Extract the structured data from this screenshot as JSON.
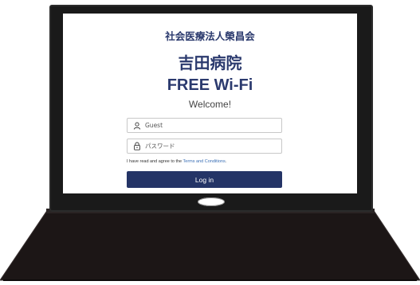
{
  "portal": {
    "org_name": "社会医療法人榮昌会",
    "hospital_name": "吉田病院",
    "wifi_title": "FREE Wi-Fi",
    "welcome": "Welcome!"
  },
  "form": {
    "username_placeholder": "Guest",
    "username_icon": "user-icon",
    "password_placeholder": "パスワード",
    "password_icon": "lock-icon",
    "terms_prefix": "I have read and agree to the ",
    "terms_link": "Terms and Conditions",
    "terms_suffix": ".",
    "login_label": "Log in"
  },
  "colors": {
    "brand": "#2b3a6e",
    "button": "#243466",
    "link": "#3a6fb5",
    "laptop": "#1a1a1a"
  }
}
